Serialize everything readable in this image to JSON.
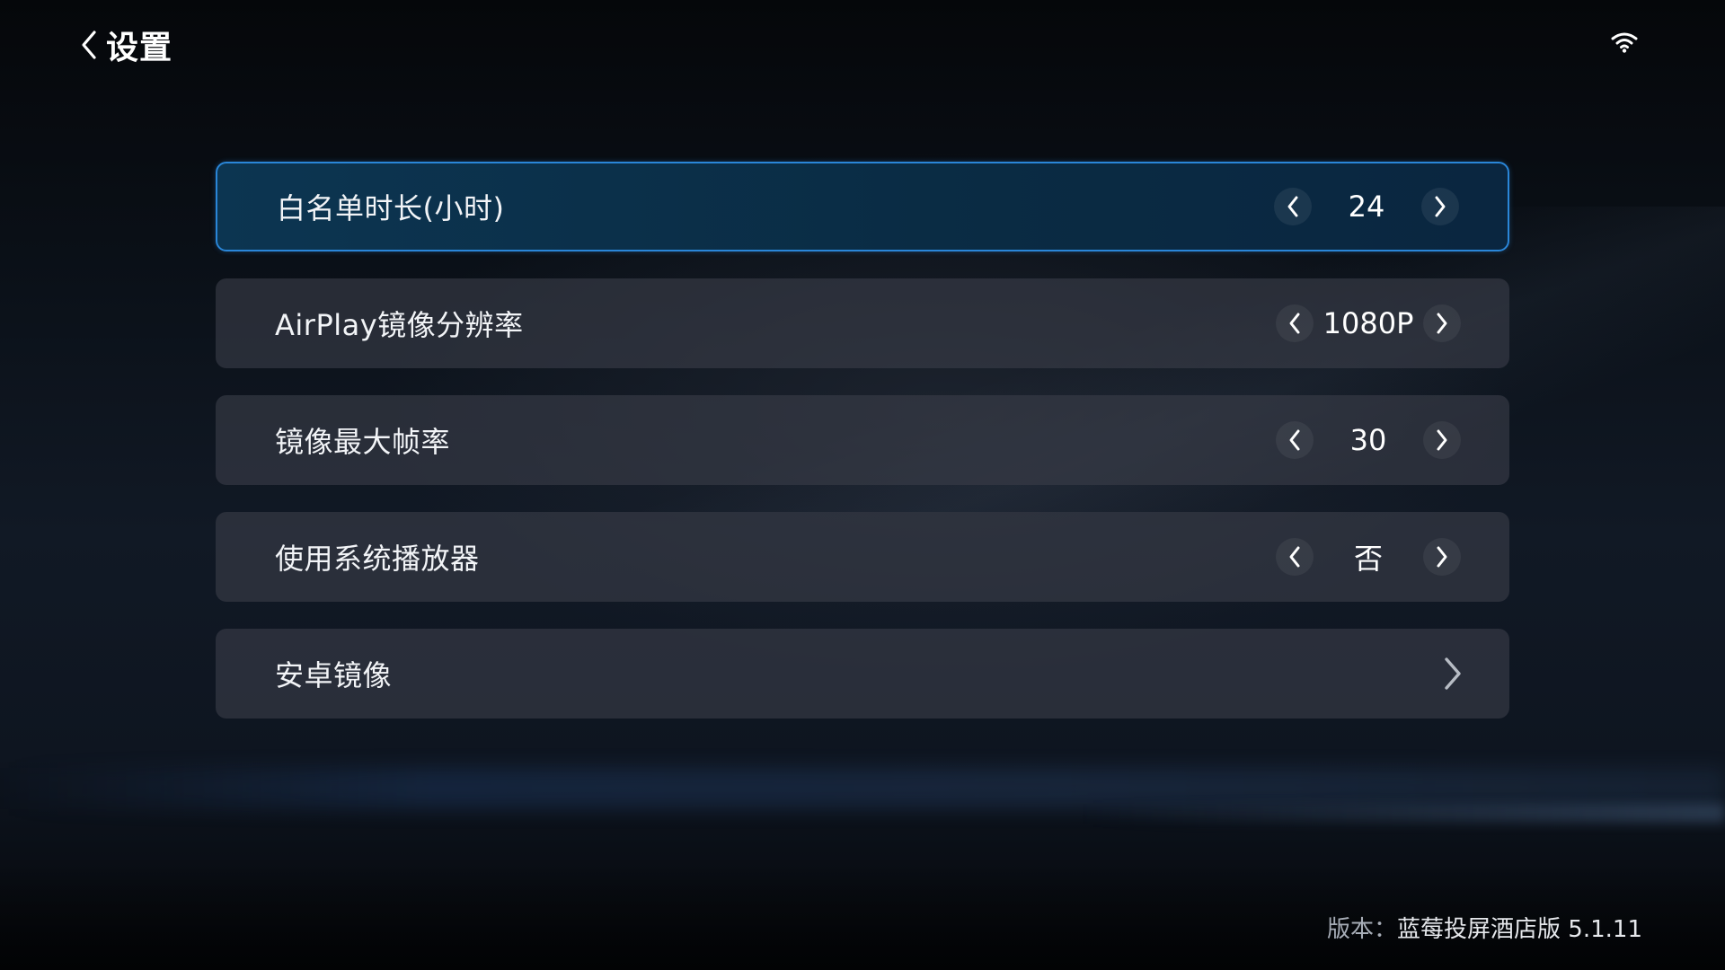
{
  "header": {
    "title": "设置",
    "back_icon": "chevron-left-icon",
    "wifi_icon": "wifi-icon"
  },
  "settings": [
    {
      "label": "白名单时长(小时)",
      "type": "stepper",
      "value": "24",
      "focused": true
    },
    {
      "label": "AirPlay镜像分辨率",
      "type": "stepper",
      "value": "1080P",
      "focused": false
    },
    {
      "label": "镜像最大帧率",
      "type": "stepper",
      "value": "30",
      "focused": false
    },
    {
      "label": "使用系统播放器",
      "type": "stepper",
      "value": "否",
      "focused": false
    },
    {
      "label": "安卓镜像",
      "type": "link",
      "focused": false
    }
  ],
  "footer": {
    "version_label": "版本：",
    "version_value": "蓝莓投屏酒店版 5.1.11"
  },
  "colors": {
    "focus_border": "#2a86d8",
    "focus_bg": "#0c3551",
    "row_bg": "#3a3e48"
  }
}
